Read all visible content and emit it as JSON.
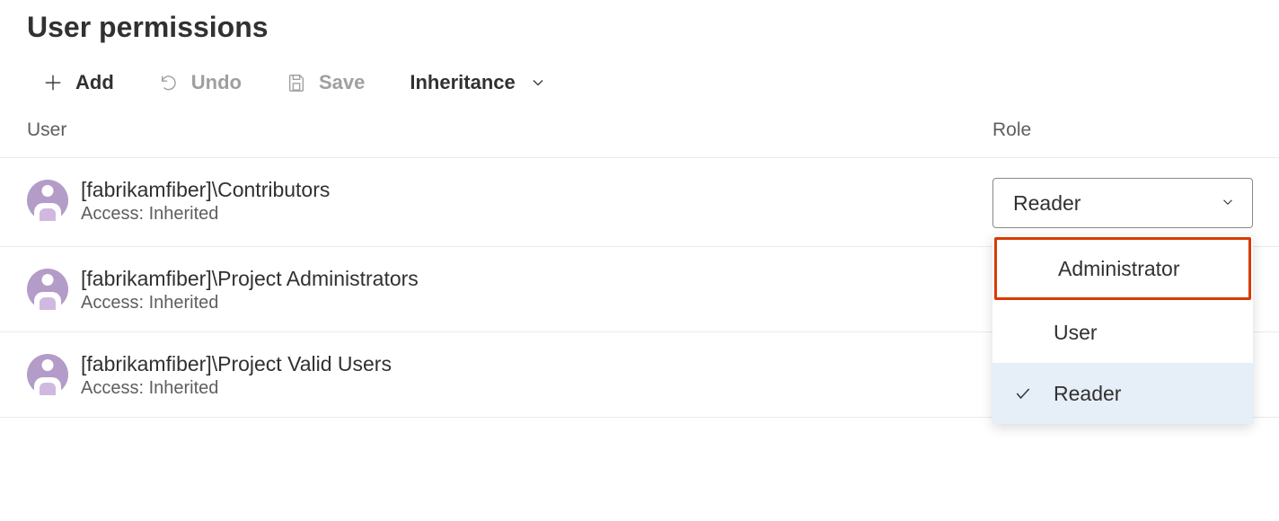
{
  "title": "User permissions",
  "toolbar": {
    "add": "Add",
    "undo": "Undo",
    "save": "Save",
    "inheritance": "Inheritance"
  },
  "headers": {
    "user": "User",
    "role": "Role"
  },
  "rows": [
    {
      "name": "[fabrikamfiber]\\Contributors",
      "access": "Access: Inherited",
      "role": "Reader"
    },
    {
      "name": "[fabrikamfiber]\\Project Administrators",
      "access": "Access: Inherited"
    },
    {
      "name": "[fabrikamfiber]\\Project Valid Users",
      "access": "Access: Inherited"
    }
  ],
  "dropdown": {
    "options": [
      "Administrator",
      "User",
      "Reader"
    ],
    "selected": "Reader",
    "highlighted": "Administrator"
  }
}
